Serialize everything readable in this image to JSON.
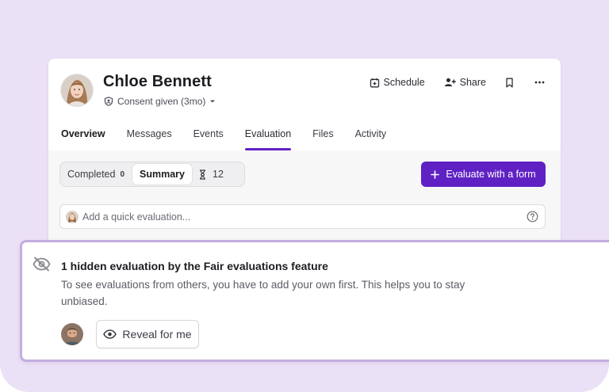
{
  "candidate": {
    "name": "Chloe Bennett",
    "consent": "Consent given (3mo)",
    "avatar_icon": "avatar-photo"
  },
  "actions": {
    "schedule": "Schedule",
    "share": "Share"
  },
  "tabs": [
    {
      "label": "Overview"
    },
    {
      "label": "Messages"
    },
    {
      "label": "Events"
    },
    {
      "label": "Evaluation"
    },
    {
      "label": "Files"
    },
    {
      "label": "Activity"
    }
  ],
  "segments": {
    "completed_label": "Completed",
    "completed_count": "0",
    "summary_label": "Summary",
    "pending_count": "12"
  },
  "evaluate_button": "Evaluate with a form",
  "quick_evaluation": {
    "placeholder": "Add a quick evaluation..."
  },
  "hidden_notice": {
    "title": "1 hidden evaluation by the Fair evaluations feature",
    "description": "To see evaluations from others, you have to add your own first. This helps you to stay unbiased.",
    "reveal_button": "Reveal for me"
  },
  "colors": {
    "accent": "#5f21c4",
    "background": "#ebe1f6",
    "panel_border": "#c4acdf"
  }
}
